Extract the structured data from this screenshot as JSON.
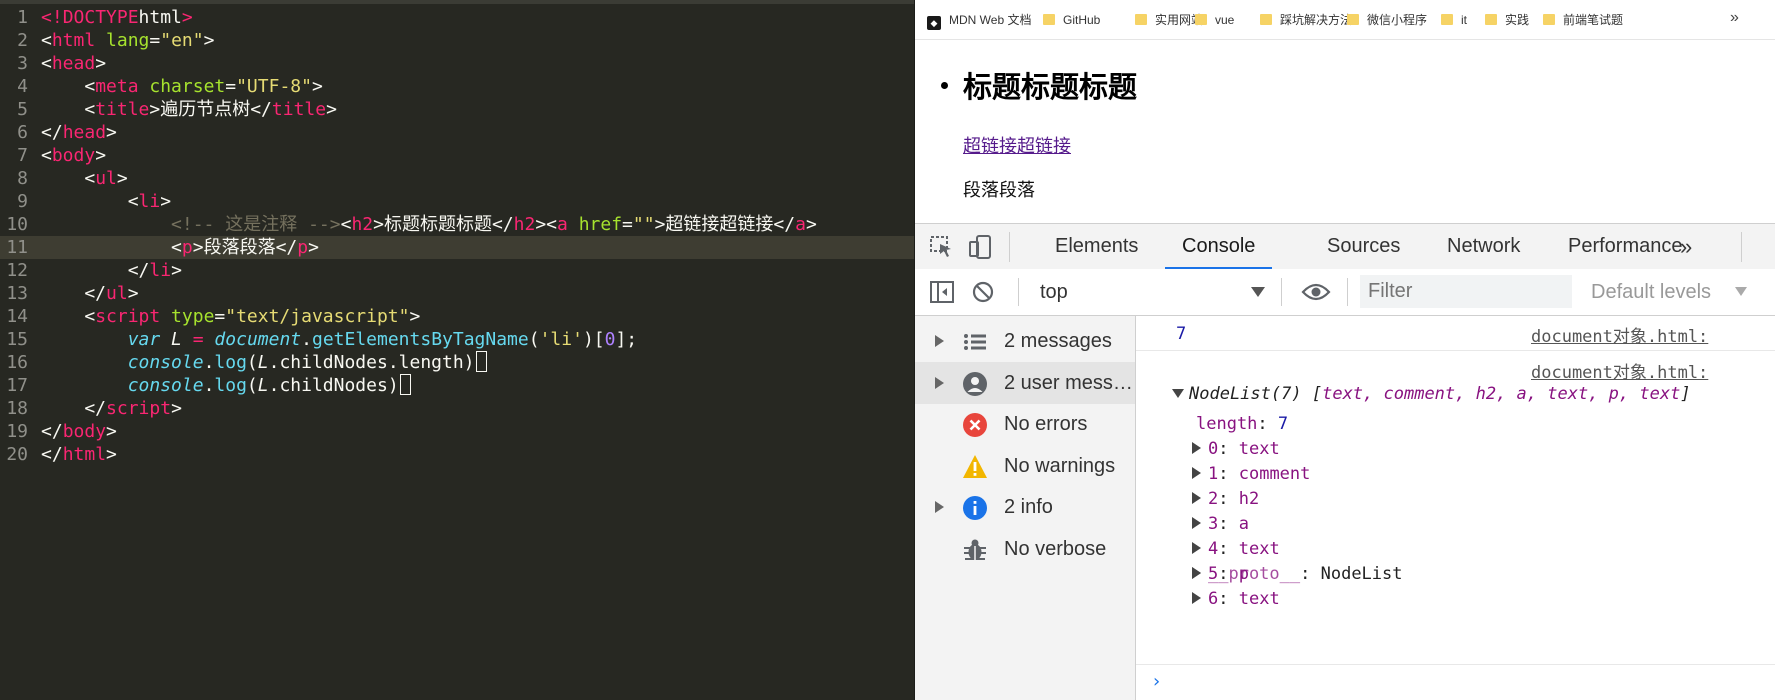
{
  "editor": {
    "lines": [
      {
        "n": "1",
        "current": false,
        "tokens": [
          [
            "t-op",
            "<!"
          ],
          [
            "t-tag",
            "DOCTYPE"
          ],
          [
            "",
            "html"
          ],
          [
            "t-op",
            ">"
          ]
        ]
      },
      {
        "n": "2",
        "current": false,
        "tokens": [
          [
            "",
            "<"
          ],
          [
            "t-tag",
            "html"
          ],
          [
            "",
            ""
          ],
          [
            "t-attr",
            " lang"
          ],
          [
            "",
            "="
          ],
          [
            "t-str",
            "\"en\""
          ],
          [
            "",
            ">"
          ]
        ]
      },
      {
        "n": "3",
        "current": false,
        "tokens": [
          [
            "",
            "<"
          ],
          [
            "t-tag",
            "head"
          ],
          [
            "",
            ">"
          ]
        ]
      },
      {
        "n": "4",
        "current": false,
        "tokens": [
          [
            "",
            "    <"
          ],
          [
            "t-tag",
            "meta"
          ],
          [
            "t-attr",
            " charset"
          ],
          [
            "",
            "="
          ],
          [
            "t-str",
            "\"UTF-8\""
          ],
          [
            "",
            ">"
          ]
        ]
      },
      {
        "n": "5",
        "current": false,
        "tokens": [
          [
            "",
            "    <"
          ],
          [
            "t-tag",
            "title"
          ],
          [
            "",
            ">遍历节点树</"
          ],
          [
            "t-tag",
            "title"
          ],
          [
            "",
            ">"
          ]
        ]
      },
      {
        "n": "6",
        "current": false,
        "tokens": [
          [
            "",
            "</"
          ],
          [
            "t-tag",
            "head"
          ],
          [
            "",
            ">"
          ]
        ]
      },
      {
        "n": "7",
        "current": false,
        "tokens": [
          [
            "",
            "<"
          ],
          [
            "t-tag",
            "body"
          ],
          [
            "",
            ">"
          ]
        ]
      },
      {
        "n": "8",
        "current": false,
        "tokens": [
          [
            "",
            "    <"
          ],
          [
            "t-tag",
            "ul"
          ],
          [
            "",
            ">"
          ]
        ]
      },
      {
        "n": "9",
        "current": false,
        "tokens": [
          [
            "",
            "        <"
          ],
          [
            "t-tag",
            "li"
          ],
          [
            "",
            ">"
          ]
        ]
      },
      {
        "n": "10",
        "current": false,
        "tokens": [
          [
            "",
            "            "
          ],
          [
            "t-cmt",
            "<!-- 这是注释 -->"
          ],
          [
            "",
            "<"
          ],
          [
            "t-tag",
            "h2"
          ],
          [
            "",
            ">标题标题标题</"
          ],
          [
            "t-tag",
            "h2"
          ],
          [
            "",
            "><"
          ],
          [
            "t-tag",
            "a"
          ],
          [
            "t-attr",
            " href"
          ],
          [
            "",
            "="
          ],
          [
            "t-str",
            "\"\""
          ],
          [
            "",
            ">超链接超链接</"
          ],
          [
            "t-tag",
            "a"
          ],
          [
            "",
            ">"
          ]
        ]
      },
      {
        "n": "11",
        "current": true,
        "tokens": [
          [
            "",
            "            <"
          ],
          [
            "t-tag",
            "p"
          ],
          [
            "",
            ">段落段落</"
          ],
          [
            "t-tag",
            "p"
          ],
          [
            "",
            ">"
          ]
        ]
      },
      {
        "n": "12",
        "current": false,
        "tokens": [
          [
            "",
            "        </"
          ],
          [
            "t-tag",
            "li"
          ],
          [
            "",
            ">"
          ]
        ]
      },
      {
        "n": "13",
        "current": false,
        "tokens": [
          [
            "",
            "    </"
          ],
          [
            "t-tag",
            "ul"
          ],
          [
            "",
            ">"
          ]
        ]
      },
      {
        "n": "14",
        "current": false,
        "tokens": [
          [
            "",
            "    <"
          ],
          [
            "t-tag",
            "script"
          ],
          [
            "t-attr",
            " type"
          ],
          [
            "",
            "="
          ],
          [
            "t-str",
            "\"text/javascript\""
          ],
          [
            "",
            ">"
          ]
        ]
      },
      {
        "n": "15",
        "current": false,
        "tokens": [
          [
            "",
            "        "
          ],
          [
            "t-kw",
            "var"
          ],
          [
            "t-var",
            " L"
          ],
          [
            "t-op",
            " ="
          ],
          [
            "t-obj",
            " document"
          ],
          [
            "",
            "."
          ],
          [
            "t-fn",
            "getElementsByTagName"
          ],
          [
            "",
            "("
          ],
          [
            "t-str",
            "'li'"
          ],
          [
            "",
            ")["
          ],
          [
            "t-num",
            "0"
          ],
          [
            "",
            "];"
          ]
        ]
      },
      {
        "n": "16",
        "current": false,
        "tokens": [
          [
            "",
            "        "
          ],
          [
            "t-obj",
            "console"
          ],
          [
            "",
            "."
          ],
          [
            "t-fn",
            "log"
          ],
          [
            "",
            "("
          ],
          [
            "t-var",
            "L"
          ],
          [
            "",
            ".childNodes.length)"
          ],
          [
            "cursor",
            ""
          ]
        ]
      },
      {
        "n": "17",
        "current": false,
        "tokens": [
          [
            "",
            "        "
          ],
          [
            "t-obj",
            "console"
          ],
          [
            "",
            "."
          ],
          [
            "t-fn",
            "log"
          ],
          [
            "",
            "("
          ],
          [
            "t-var",
            "L"
          ],
          [
            "",
            ".childNodes)"
          ],
          [
            "cursor",
            ""
          ]
        ]
      },
      {
        "n": "18",
        "current": false,
        "tokens": [
          [
            "",
            "    </"
          ],
          [
            "t-tag",
            "script"
          ],
          [
            "",
            ">"
          ]
        ]
      },
      {
        "n": "19",
        "current": false,
        "tokens": [
          [
            "",
            "</"
          ],
          [
            "t-tag",
            "body"
          ],
          [
            "",
            ">"
          ]
        ]
      },
      {
        "n": "20",
        "current": false,
        "tokens": [
          [
            "",
            "</"
          ],
          [
            "t-tag",
            "html"
          ],
          [
            "",
            ">"
          ]
        ]
      }
    ]
  },
  "bookmarks": [
    {
      "label": "MDN Web 文档",
      "icon": "mdn-icon"
    },
    {
      "label": "GitHub",
      "icon": "folder-icon"
    },
    {
      "label": "实用网站",
      "icon": "folder-icon"
    },
    {
      "label": "vue",
      "icon": "folder-icon"
    },
    {
      "label": "踩坑解决方法",
      "icon": "folder-icon"
    },
    {
      "label": "微信小程序",
      "icon": "folder-icon"
    },
    {
      "label": "it",
      "icon": "folder-icon"
    },
    {
      "label": "实践",
      "icon": "folder-icon"
    },
    {
      "label": "前端笔试题",
      "icon": "folder-icon"
    }
  ],
  "bookmarks_more": "»",
  "page": {
    "heading": "标题标题标题",
    "link": "超链接超链接",
    "paragraph": "段落段落"
  },
  "devtools": {
    "tabs": [
      "Elements",
      "Console",
      "Sources",
      "Network",
      "Performance"
    ],
    "active_tab": "Console",
    "more": "»",
    "context": "top",
    "filter_placeholder": "Filter",
    "levels": "Default levels"
  },
  "sidebar": [
    {
      "label": "2 messages",
      "icon": "list-icon",
      "expandable": true,
      "selected": false
    },
    {
      "label": "2 user mess…",
      "icon": "user-icon",
      "expandable": true,
      "selected": true
    },
    {
      "label": "No errors",
      "icon": "error-icon",
      "expandable": false,
      "selected": false
    },
    {
      "label": "No warnings",
      "icon": "warning-icon",
      "expandable": false,
      "selected": false
    },
    {
      "label": "2 info",
      "icon": "info-icon",
      "expandable": true,
      "selected": false
    },
    {
      "label": "No verbose",
      "icon": "bug-icon",
      "expandable": false,
      "selected": false
    }
  ],
  "console": {
    "first_value": "7",
    "source": "document对象.html:",
    "nodelist_head": "NodeList(7)",
    "nodelist_items": "text, comment, h2, a, text, p, text",
    "length_key": "length",
    "length_val": "7",
    "children": [
      {
        "key": "0",
        "val": "text"
      },
      {
        "key": "1",
        "val": "comment"
      },
      {
        "key": "2",
        "val": "h2"
      },
      {
        "key": "3",
        "val": "a"
      },
      {
        "key": "4",
        "val": "text"
      },
      {
        "key": "5",
        "val": "p"
      },
      {
        "key": "6",
        "val": "text"
      }
    ],
    "proto_key": "__proto__",
    "proto_val": "NodeList",
    "prompt": "›"
  },
  "colors": {
    "editor_bg": "#272822",
    "accent": "#1a73e8",
    "tag": "#f92672",
    "attr": "#a6e22e",
    "string": "#e6db74",
    "comment": "#75715e"
  }
}
